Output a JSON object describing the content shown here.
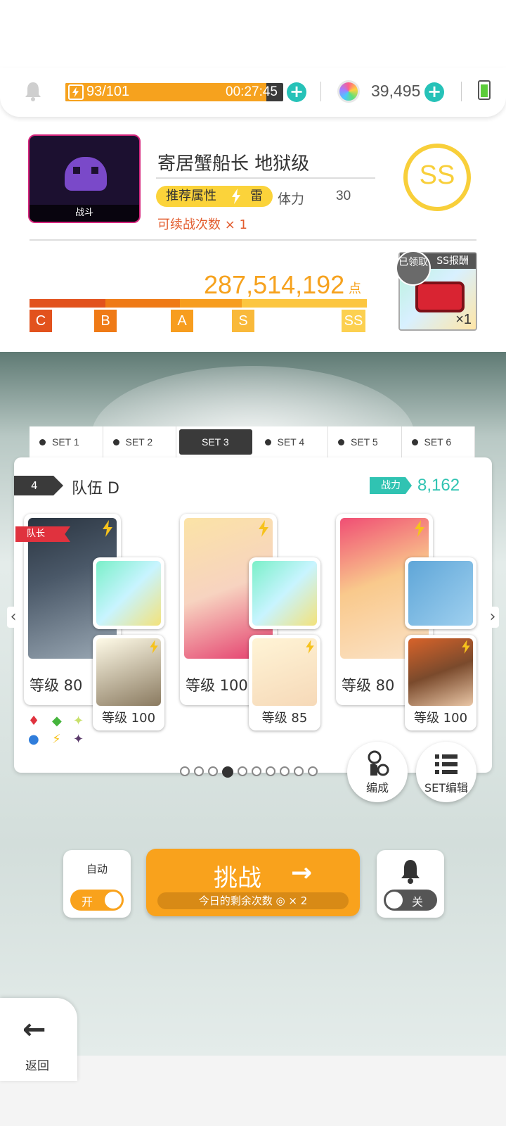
{
  "status": {
    "stamina_text": "93/101",
    "stamina_fraction": 0.921,
    "timer": "00:27:45",
    "gems": "39,495",
    "icons": [
      "bell-icon",
      "bolt-icon",
      "plus-icon",
      "rainbow-orb-icon",
      "battery-icon"
    ]
  },
  "stage": {
    "thumb_label": "战斗",
    "title": "寄居蟹船长 地狱级",
    "attr_label": "推荐属性",
    "attr_element": "雷",
    "stamina_label": "体力",
    "stamina_cost": "30",
    "retry_text": "可续战次数 × 1",
    "rank": "SS"
  },
  "score": {
    "value": "287,514,192",
    "unit": "点",
    "progress_fraction": 1.0,
    "marks": [
      "C",
      "B",
      "A",
      "S",
      "SS"
    ],
    "colors": {
      "C": "#e2521d",
      "B": "#ef7a16",
      "A": "#f79d1e",
      "S": "#f9b93a",
      "SS": "#fcd050"
    }
  },
  "reward": {
    "header": "SS报酬",
    "claimed": "已领取",
    "qty": "×1"
  },
  "tabs": [
    "SET 1",
    "SET 2",
    "SET 3",
    "SET 4",
    "SET 5",
    "SET 6"
  ],
  "active_tab": 2,
  "team": {
    "number": "4",
    "name": "队伍 D",
    "power_label": "战力",
    "power_value": "8,162",
    "leader_label": "队长",
    "units": [
      {
        "main_level": "等级 80",
        "sub_level": "等级 100",
        "weapon": "staff",
        "accent": "#2bbfa8"
      },
      {
        "main_level": "等级 100",
        "sub_level": "等级 85",
        "weapon": "wand",
        "accent": "#f2c14e"
      },
      {
        "main_level": "等级 80",
        "sub_level": "等级 100",
        "weapon": "book",
        "accent": "#e76a5c"
      }
    ]
  },
  "pager": {
    "count": 10,
    "active": 3
  },
  "buttons": {
    "formation": "编成",
    "set_edit": "SET编辑",
    "auto_label": "自动",
    "auto_state": "开",
    "challenge": "挑战",
    "remaining": "今日的剩余次数",
    "remaining_count": "× 2",
    "notify_state": "关",
    "back": "返回"
  },
  "colors": {
    "accent_teal": "#30c3b2",
    "accent_orange": "#f9a21c",
    "gold": "#f8cf3a"
  }
}
